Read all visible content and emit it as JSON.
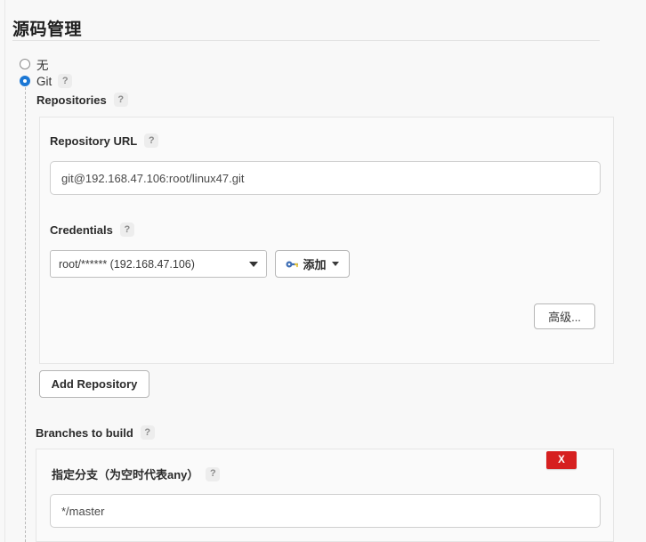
{
  "section": {
    "title": "源码管理"
  },
  "scm_options": [
    {
      "label": "无",
      "selected": false,
      "has_help": false
    },
    {
      "label": "Git",
      "selected": true,
      "has_help": true
    }
  ],
  "repositories": {
    "label": "Repositories",
    "help": "?",
    "repo_url": {
      "label": "Repository URL",
      "help": "?",
      "value": "git@192.168.47.106:root/linux47.git",
      "placeholder": ""
    },
    "credentials": {
      "label": "Credentials",
      "help": "?",
      "selected": "root/****** (192.168.47.106)",
      "options": [
        "root/****** (192.168.47.106)"
      ],
      "add_button": {
        "label": "添加",
        "icon": "key-icon"
      }
    },
    "advanced_button": "高级...",
    "add_repository_button": "Add Repository"
  },
  "branches": {
    "label": "Branches to build",
    "help": "?",
    "branch_spec": {
      "label": "指定分支（为空时代表any）",
      "help": "?",
      "value": "*/master",
      "placeholder": ""
    },
    "delete_badge": "X"
  },
  "colors": {
    "accent": "#1b77d4",
    "danger": "#d62020",
    "panel_bg": "#fafafa",
    "page_bg": "#f8f8f8"
  },
  "help_glyph": "?"
}
